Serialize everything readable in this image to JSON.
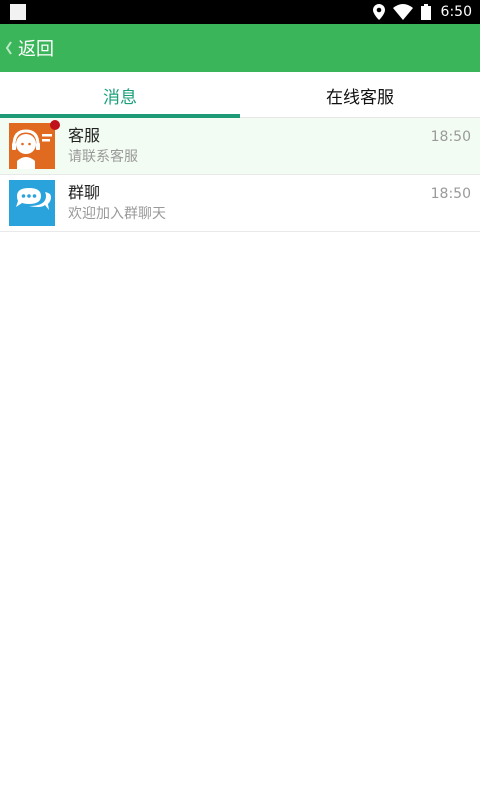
{
  "status_bar": {
    "time": "6:50",
    "icons": [
      "notification-square-icon",
      "location-icon",
      "wifi-icon",
      "battery-icon"
    ]
  },
  "app_bar": {
    "back_label": "返回",
    "back_icon": "chevron-left-icon",
    "color": "#3ab55a"
  },
  "tabs": [
    {
      "label": "消息",
      "active": true
    },
    {
      "label": "在线客服",
      "active": false
    }
  ],
  "accent": "#1f9a76",
  "conversations": [
    {
      "title": "客服",
      "subtitle": "请联系客服",
      "time": "18:50",
      "icon": "customer-service-icon",
      "icon_bg": "#e06a1f",
      "unread": true
    },
    {
      "title": "群聊",
      "subtitle": "欢迎加入群聊天",
      "time": "18:50",
      "icon": "group-chat-icon",
      "icon_bg": "#2aa3dd",
      "unread": false
    }
  ]
}
